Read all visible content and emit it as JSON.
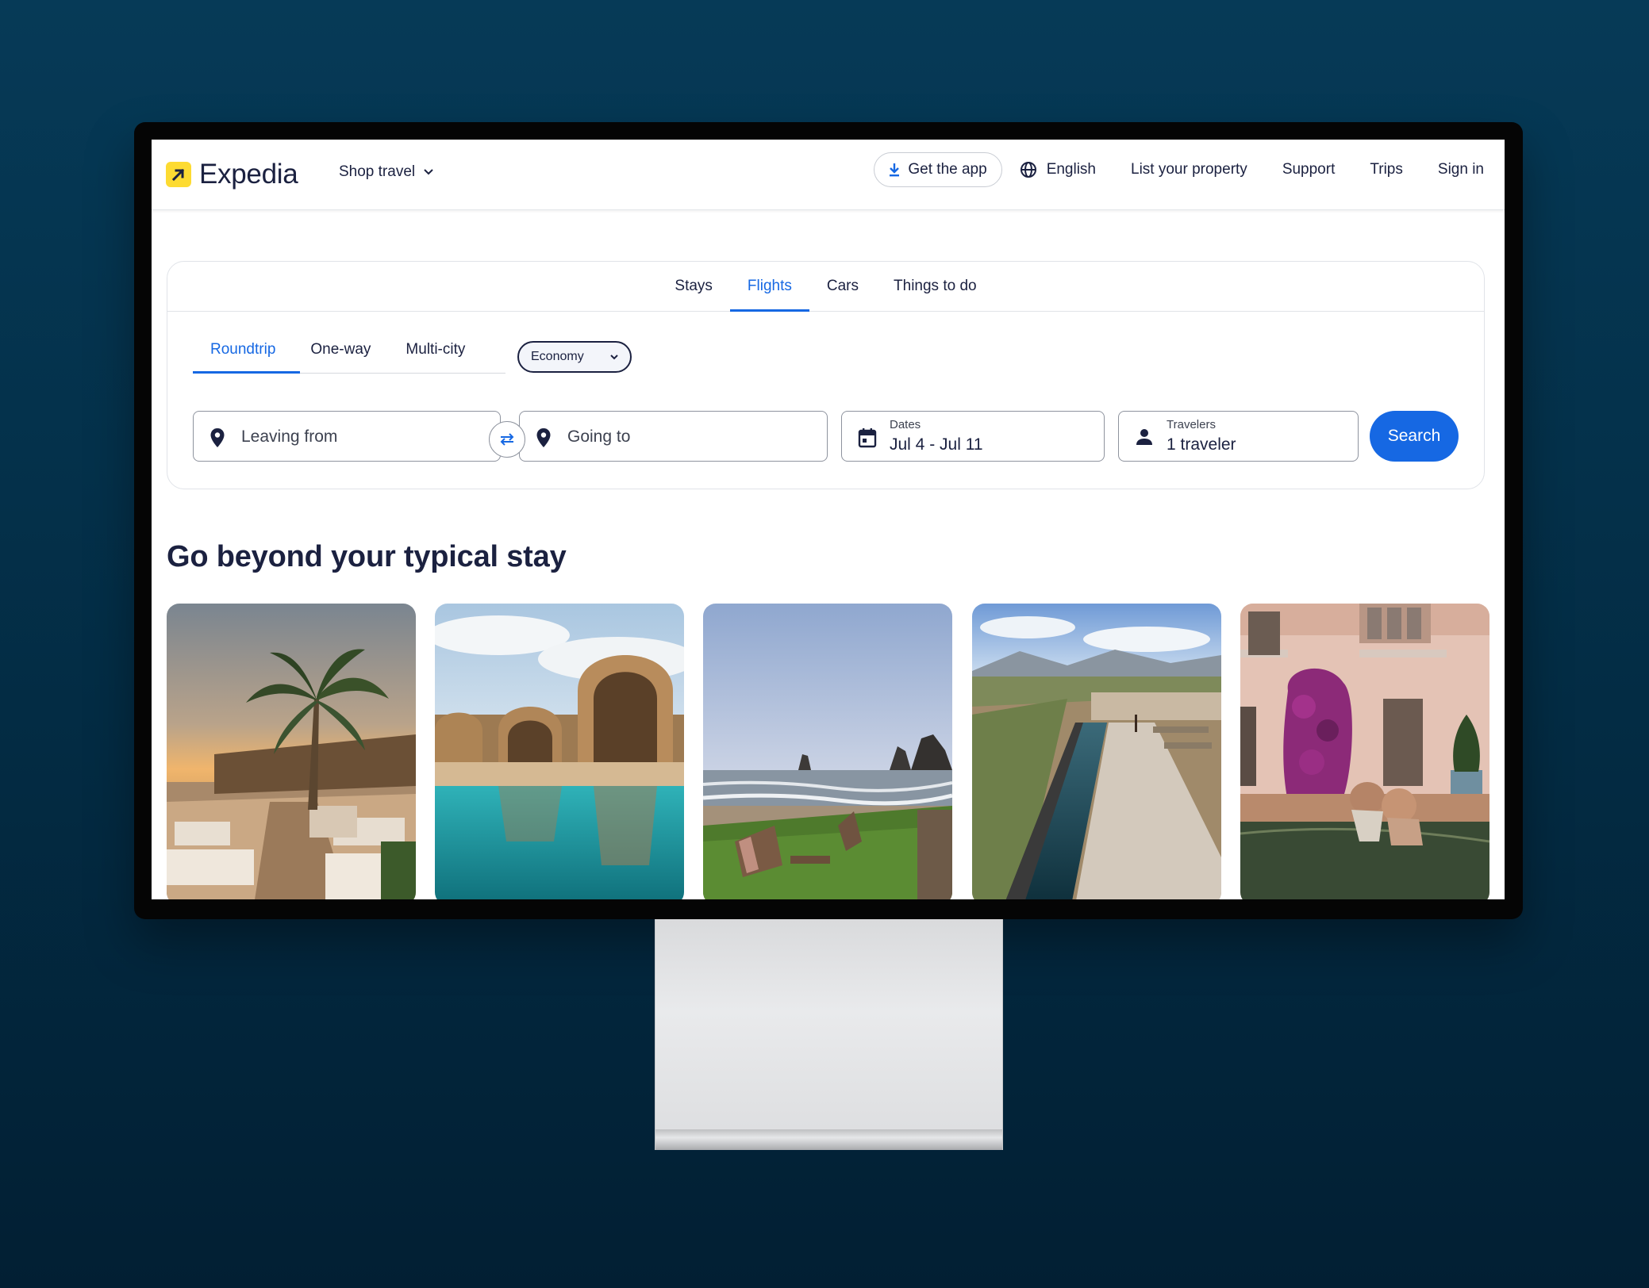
{
  "header": {
    "brand": "Expedia",
    "shop_travel": "Shop travel",
    "get_app": "Get the app",
    "language": "English",
    "list_property": "List your property",
    "support": "Support",
    "trips": "Trips",
    "sign_in": "Sign in"
  },
  "search": {
    "tabs": [
      "Stays",
      "Flights",
      "Cars",
      "Things to do"
    ],
    "active_tab": "Flights",
    "trip_types": [
      "Roundtrip",
      "One-way",
      "Multi-city"
    ],
    "active_trip_type": "Roundtrip",
    "cabin_class": "Economy",
    "leaving_from_placeholder": "Leaving from",
    "going_to_placeholder": "Going to",
    "dates_label": "Dates",
    "dates_value": "Jul 4 - Jul 11",
    "travelers_label": "Travelers",
    "travelers_value": "1 traveler",
    "search_button": "Search"
  },
  "section": {
    "title": "Go beyond your typical stay"
  },
  "colors": {
    "accent": "#1668e3",
    "brand_yellow": "#fddb32",
    "text": "#1b2140"
  }
}
